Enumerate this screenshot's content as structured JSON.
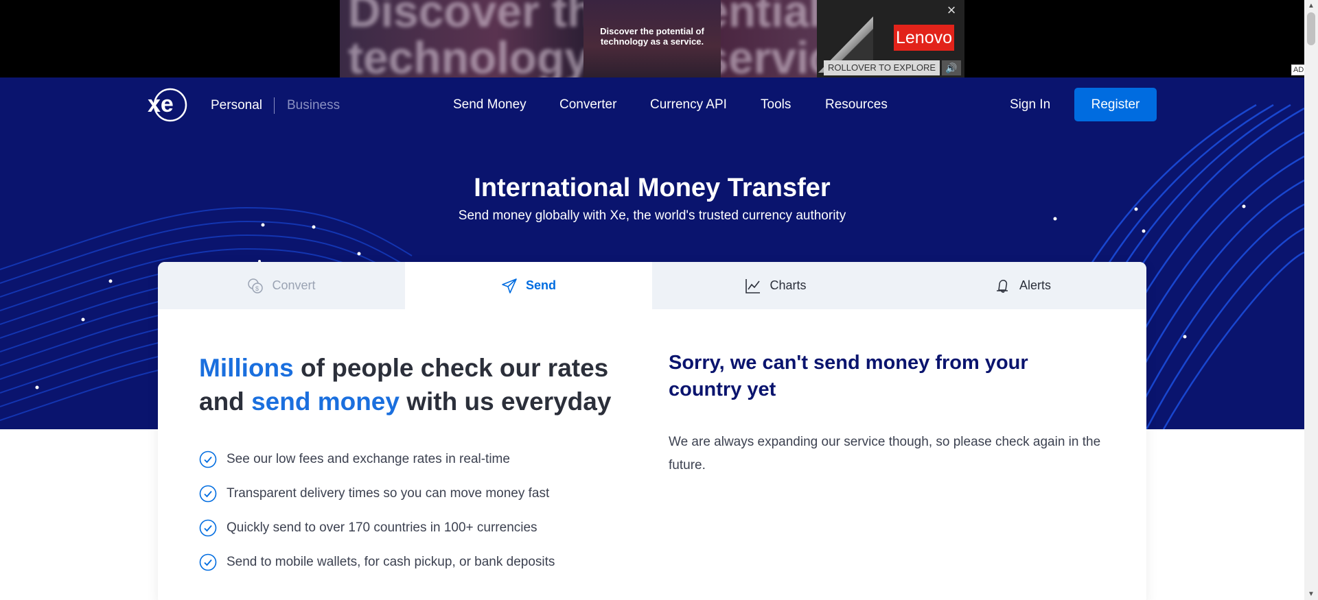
{
  "ad": {
    "copy_line1": "Discover the potential of",
    "copy_line2": "technology as a service.",
    "blur_line1": "Discover the potential of",
    "blur_line2": "technology as a service",
    "brand": "Lenovo",
    "rollover": "ROLLOVER TO EXPLORE",
    "tag": "AD"
  },
  "nav": {
    "segments": {
      "personal": "Personal",
      "business": "Business"
    },
    "links": [
      "Send Money",
      "Converter",
      "Currency API",
      "Tools",
      "Resources"
    ],
    "sign_in": "Sign In",
    "register": "Register"
  },
  "hero": {
    "title": "International Money Transfer",
    "subtitle": "Send money globally with Xe, the world's trusted currency authority"
  },
  "tabs": [
    {
      "label": "Convert",
      "icon": "coins-icon",
      "state": "disabled"
    },
    {
      "label": "Send",
      "icon": "send-icon",
      "state": "active"
    },
    {
      "label": "Charts",
      "icon": "chart-icon",
      "state": "inactive"
    },
    {
      "label": "Alerts",
      "icon": "bell-icon",
      "state": "inactive"
    }
  ],
  "left": {
    "headline_1": "Millions",
    "headline_2": " of people check our rates and ",
    "headline_3": "send money",
    "headline_4": " with us everyday",
    "features": [
      "See our low fees and exchange rates in real-time",
      "Transparent delivery times so you can move money fast",
      "Quickly send to over 170 countries in 100+ currencies",
      "Send to mobile wallets, for cash pickup, or bank deposits"
    ]
  },
  "right": {
    "title": "Sorry, we can't send money from your country yet",
    "text": "We are always expanding our service though, so please check again in the future."
  },
  "colors": {
    "hero_bg": "#0a146e",
    "accent": "#006ce0",
    "headline_blue": "#1a6fde",
    "lenovo_red": "#e2231a"
  }
}
